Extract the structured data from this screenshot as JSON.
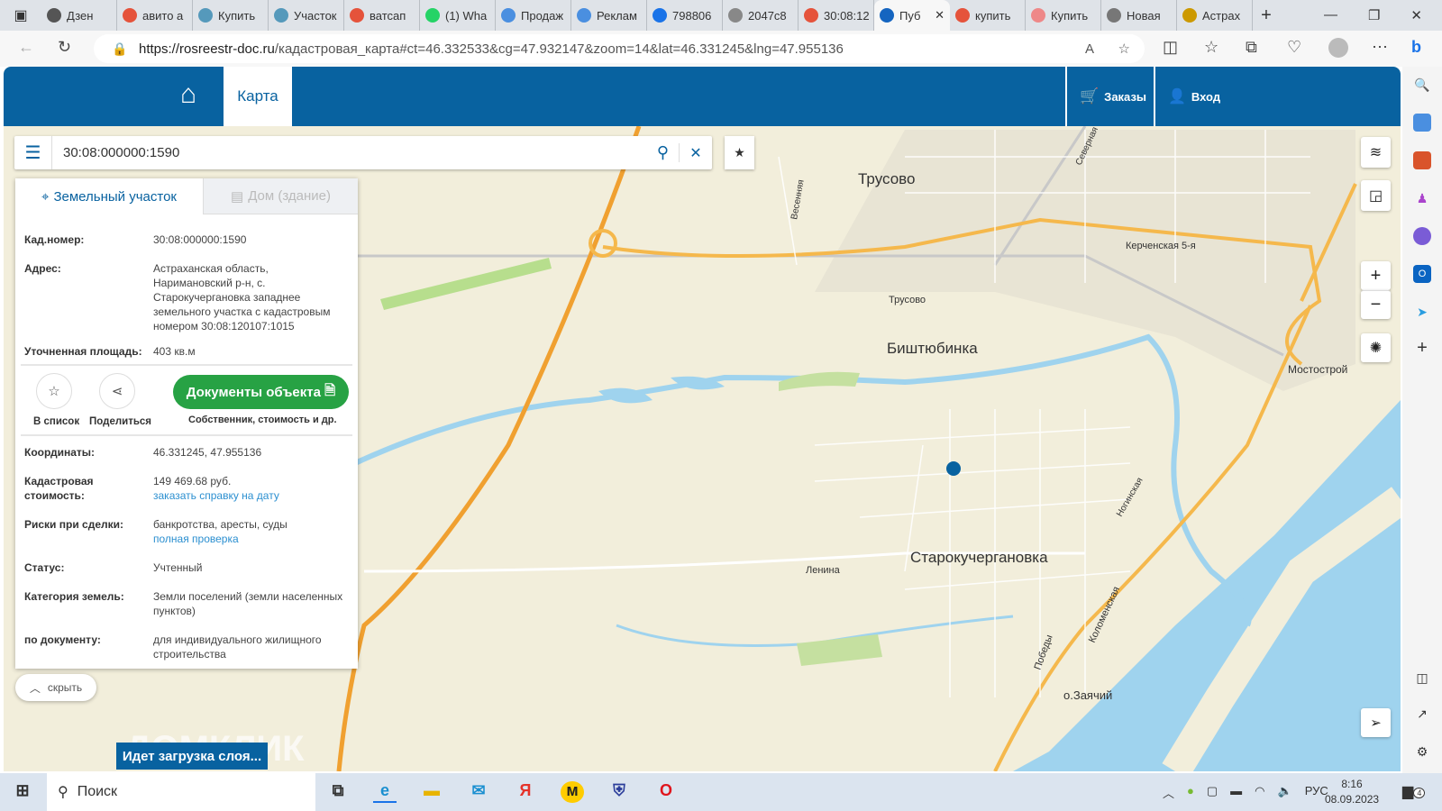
{
  "browser": {
    "tabs": [
      {
        "label": "Дзен",
        "color": "#555"
      },
      {
        "label": "авито а",
        "color": "#e5533b"
      },
      {
        "label": "Купить",
        "color": "#59b"
      },
      {
        "label": "Участок",
        "color": "#59b"
      },
      {
        "label": "ватсап",
        "color": "#e5533b"
      },
      {
        "label": "(1) Wha",
        "color": "#25d366"
      },
      {
        "label": "Продаж",
        "color": "#4a8fe0"
      },
      {
        "label": "Реклам",
        "color": "#4a8fe0"
      },
      {
        "label": "798806",
        "color": "#1a73e8"
      },
      {
        "label": "2047c8",
        "color": "#888"
      },
      {
        "label": "30:08:12",
        "color": "#e5533b"
      },
      {
        "label": "Пуб",
        "color": "#1565c0",
        "active": true
      },
      {
        "label": "купить",
        "color": "#e5533b"
      },
      {
        "label": "Купить",
        "color": "#e88"
      },
      {
        "label": "Новая",
        "color": "#777"
      },
      {
        "label": "Астрах",
        "color": "#c90"
      }
    ],
    "url_host": "https://rosreestr-doc.ru",
    "url_path": "/кадастровая_карта#ct=46.332533&cg=47.932147&zoom=14&lat=46.331245&lng=47.955136"
  },
  "header": {
    "nav_map": "Карта",
    "orders": "Заказы",
    "login": "Вход"
  },
  "search": {
    "value": "30:08:000000:1590"
  },
  "panel": {
    "tab_land": "Земельный участок",
    "tab_house": "Дом (здание)",
    "cad_label": "Кад.номер:",
    "cad_value": "30:08:000000:1590",
    "addr_label": "Адрес:",
    "addr_value": "Астраханская область, Наримановский р-н, с. Старокучергановка западнее земельного участка с кадастровым номером 30:08:120107:1015",
    "area_label": "Уточненная площадь:",
    "area_value": "403 кв.м",
    "add_list": "В список",
    "share": "Поделиться",
    "docs_button": "Документы объекта",
    "docs_sub": "Собственник, стоимость и др.",
    "coords_label": "Координаты:",
    "coords_value": "46.331245, 47.955136",
    "cost_label": "Кадастровая стоимость:",
    "cost_value": "149 469.68 руб.",
    "cost_link": "заказать справку на дату",
    "risk_label": "Риски при сделки:",
    "risk_value": "банкротства, аресты, суды",
    "risk_link": "полная проверка",
    "status_label": "Статус:",
    "status_value": "Учтенный",
    "cat_label": "Категория земель:",
    "cat_value": "Земли поселений (земли населенных пунктов)",
    "doc_label": "по документу:",
    "doc_value": "для индивидуального жилищного строительства",
    "hide": "скрыть"
  },
  "map": {
    "labels": {
      "trusovo": "Трусово",
      "trusovo_st": "Трусово",
      "bisht": "Биштюбинка",
      "staro": "Старокучергановка",
      "mostostroy": "Мостострой",
      "zayachiy": "о.Заячий",
      "lenina": "Ленина",
      "kerch": "Керченская 5-я",
      "kolom": "Коломенская",
      "pobedy": "Победы",
      "nogin": "Ногинская",
      "vesen": "Весенняя",
      "sever": "Северная"
    },
    "loading": "Идет загрузка слоя...",
    "watermark": "ДОМКЛИК"
  },
  "taskbar": {
    "search": "Поиск",
    "lang": "РУС",
    "time": "8:16",
    "date": "08.09.2023",
    "notif": "4"
  }
}
